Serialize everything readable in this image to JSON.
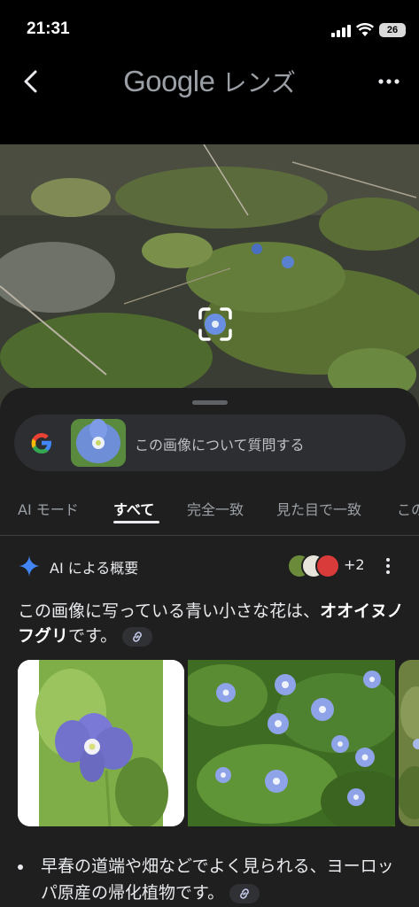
{
  "status": {
    "time": "21:31",
    "battery": "26"
  },
  "appbar": {
    "title_brand": "Google",
    "title_app": "レンズ"
  },
  "search": {
    "ask_placeholder": "この画像について質問する"
  },
  "tabs": [
    {
      "label": "AI モード"
    },
    {
      "label": "すべて",
      "active": true
    },
    {
      "label": "完全一致"
    },
    {
      "label": "見た目で一致"
    },
    {
      "label": "この"
    }
  ],
  "overview": {
    "title": "AI による概要",
    "sources_more": "+2",
    "answer_prefix": "この画像に写っている青い小さな花は、",
    "answer_bold": "オオイヌノフグリ",
    "answer_suffix": "です。",
    "bullets": [
      {
        "text": "早春の道端や畑などでよく見られる、ヨーロッパ原産の帰化植物です。"
      }
    ]
  },
  "icons": {
    "back": "back-arrow-icon",
    "more": "more-horiz-icon",
    "google": "google-g-icon",
    "sparkle": "sparkle-icon",
    "link": "link-icon",
    "kebab": "more-vert-icon",
    "scan": "lens-scan-icon"
  },
  "colors": {
    "background": "#000000",
    "sheet": "#1f1f1f",
    "askbar": "#2d2e31",
    "accent_blue": "#4285f4"
  }
}
